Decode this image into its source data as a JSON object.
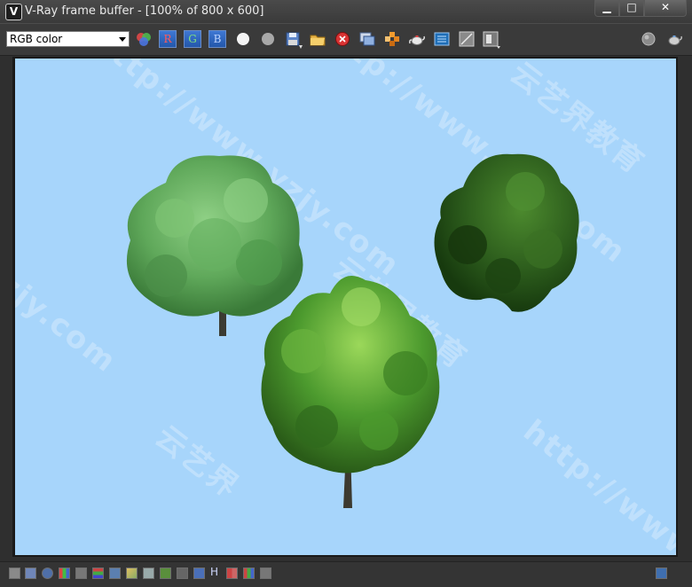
{
  "window": {
    "title": "V-Ray frame buffer - [100% of 800 x 600]",
    "app_icon_glyph": "V",
    "min_glyph": "▁",
    "max_glyph": "□",
    "close_glyph": "✕"
  },
  "toolbar": {
    "channel_value": "RGB color",
    "red_label": "R",
    "green_label": "G",
    "blue_label": "B"
  },
  "canvas": {
    "background": "#a7d5fb",
    "watermarks": [
      "http://www.yzjy.com",
      "云艺界教育",
      "http://www.yzjy.com",
      "云艺界教育",
      "yzjy.com",
      "http://www.",
      "云艺界"
    ]
  },
  "statusbar": {
    "h_label": "H"
  },
  "colors": {
    "accent": "#2f6bcf",
    "tree_light": "#5fa85a",
    "tree_mid": "#4c9a2e",
    "tree_dark": "#1f4d12"
  }
}
